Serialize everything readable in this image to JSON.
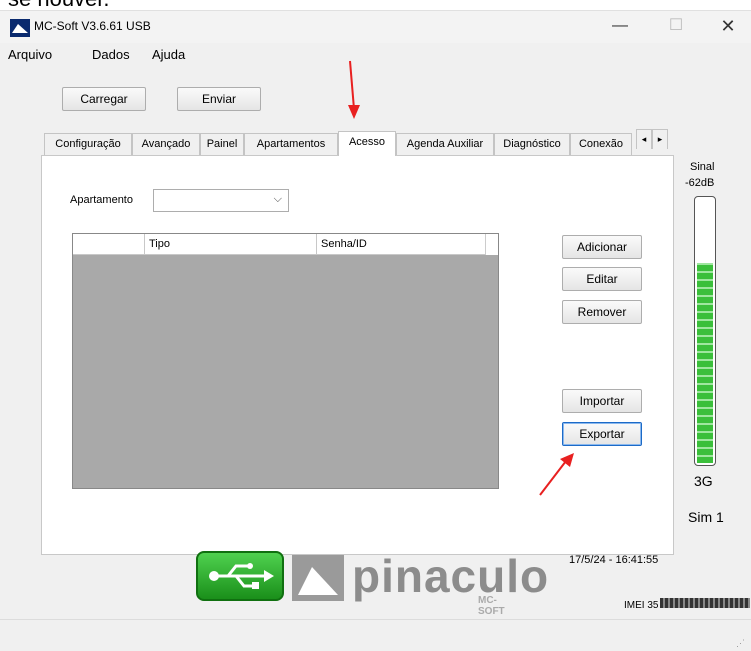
{
  "top_crop_text": "se houver.",
  "window": {
    "title": "MC-Soft V3.6.61 USB"
  },
  "menu": [
    "Arquivo",
    "Dados",
    "Ajuda"
  ],
  "toolbar": {
    "load_label": "Carregar",
    "send_label": "Enviar"
  },
  "tabs": [
    "Configuração",
    "Avançado",
    "Painel",
    "Apartamentos",
    "Acesso",
    "Agenda Auxiliar",
    "Diagnóstico",
    "Conexão"
  ],
  "active_tab": "Acesso",
  "form": {
    "apartment_label": "Apartamento",
    "apartment_value": ""
  },
  "table": {
    "columns": [
      "",
      "Tipo",
      "Senha/ID"
    ],
    "rows": []
  },
  "actions": {
    "add": "Adicionar",
    "edit": "Editar",
    "remove": "Remover",
    "import": "Importar",
    "export": "Exportar"
  },
  "signal": {
    "label": "Sinal",
    "level": "-62dB",
    "network": "3G",
    "sim": "Sim 1"
  },
  "logo": {
    "brand": "pinaculo",
    "sub": "MC-SOFT"
  },
  "status": {
    "datetime": "17/5/24 - 16:41:55",
    "imei_prefix": "IMEI 35"
  },
  "colors": {
    "arrow": "#e82020",
    "usb_green": "#2db52d",
    "meter_green": "#3bbf3b"
  }
}
